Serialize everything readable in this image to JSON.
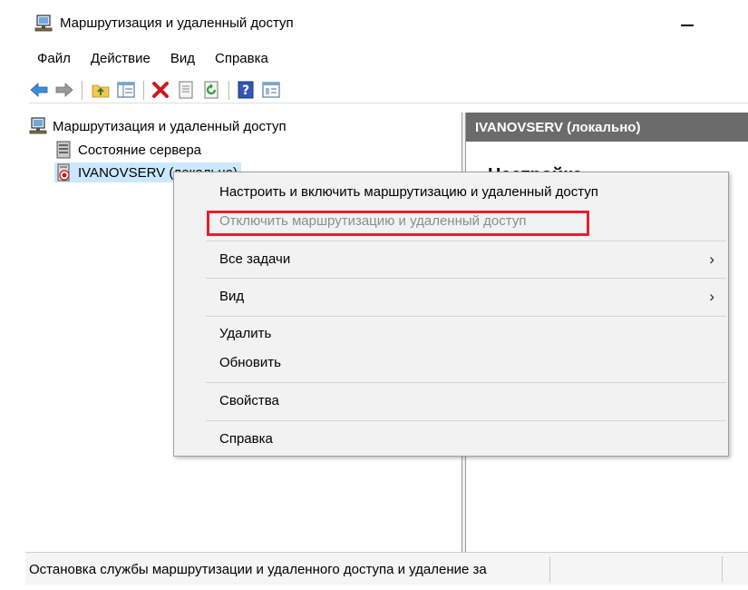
{
  "window": {
    "title": "Маршрутизация и удаленный доступ",
    "minimize_icon": "minimize-icon"
  },
  "menubar": {
    "items": [
      "Файл",
      "Действие",
      "Вид",
      "Справка"
    ]
  },
  "toolbar": {
    "icons": [
      "back-arrow-icon",
      "forward-arrow-icon",
      "up-folder-icon",
      "show-hide-tree-icon",
      "delete-icon",
      "properties-icon",
      "refresh-icon",
      "help-icon",
      "export-list-icon"
    ]
  },
  "tree": {
    "root_label": "Маршрутизация и удаленный доступ",
    "items": [
      {
        "label": "Состояние сервера",
        "icon": "server-status-icon"
      },
      {
        "label": "IVANOVSERV (локально)",
        "icon": "server-stopped-icon",
        "selected": true
      }
    ]
  },
  "result_pane": {
    "header": "IVANOVSERV (локально)",
    "heading": "Настройка"
  },
  "context_menu": {
    "items": [
      {
        "label": "Настроить и включить маршрутизацию и удаленный доступ",
        "disabled": false
      },
      {
        "label": "Отключить маршрутизацию и удаленный доступ",
        "disabled": true,
        "highlighted": true
      },
      {
        "label": "Все задачи",
        "submenu": true
      },
      {
        "label": "Вид",
        "submenu": true
      },
      {
        "label": "Удалить"
      },
      {
        "label": "Обновить"
      },
      {
        "label": "Свойства"
      },
      {
        "label": "Справка"
      }
    ],
    "submenu_arrow": "›",
    "highlight_color": "#e8202a"
  },
  "statusbar": {
    "text": "Остановка службы маршрутизации и удаленного доступа и удаление за"
  },
  "colors": {
    "result_header_bg": "#6b6b6b",
    "selection_bg": "#cce8ff",
    "disabled_text": "#8d8d8d"
  }
}
